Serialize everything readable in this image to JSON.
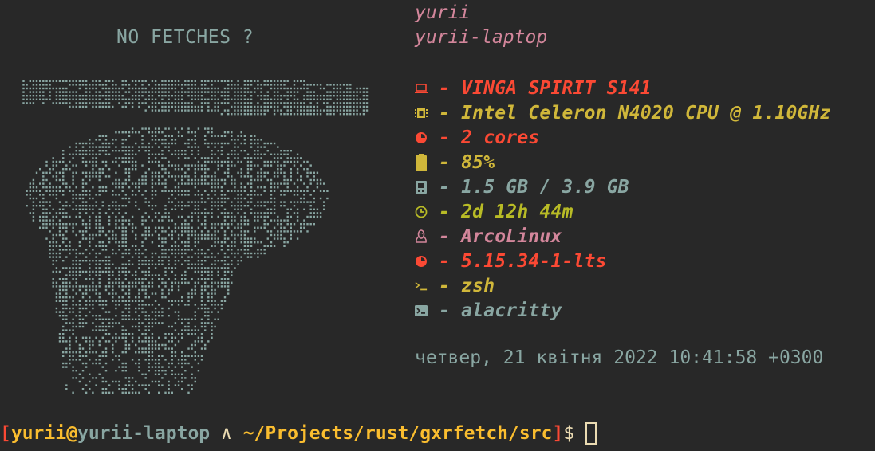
{
  "art": {
    "title": "NO FETCHES ?",
    "color": "#89a6a2"
  },
  "header": {
    "user": "yurii",
    "host": "yurii-laptop"
  },
  "info": [
    {
      "icon": "laptop-icon",
      "text": "- VINGA SPIRIT S141",
      "color": "#fb4934"
    },
    {
      "icon": "cpu-chip-icon",
      "text": "- Intel Celeron N4020 CPU @ 1.10GHz",
      "color": "#d0b73a"
    },
    {
      "icon": "pie-chart-icon",
      "text": "- 2 cores",
      "color": "#fb4934"
    },
    {
      "icon": "battery-icon",
      "text": "- 85%",
      "color": "#d0b73a"
    },
    {
      "icon": "memory-icon",
      "text": "- 1.5 GB / 3.9 GB",
      "color": "#89a6a2"
    },
    {
      "icon": "clock-icon",
      "text": "- 2d 12h 44m",
      "color": "#b8bb26"
    },
    {
      "icon": "linux-tux-icon",
      "text": "- ArcoLinux",
      "color": "#d3869b"
    },
    {
      "icon": "kernel-icon",
      "text": "- 5.15.34-1-lts",
      "color": "#fb4934"
    },
    {
      "icon": "shell-prompt-icon",
      "text": "- zsh",
      "color": "#d0b73a"
    },
    {
      "icon": "terminal-icon",
      "text": "- alacritty",
      "color": "#89a6a2"
    }
  ],
  "date": "четвер, 21 квітня 2022 10:41:58 +0300",
  "prompt": {
    "open_bracket": "[",
    "user": "yurii",
    "at": "@",
    "host": "yurii-laptop",
    "arrow": " ∧ ",
    "path": "~/Projects/rust/gxrfetch/src",
    "close_bracket": "]",
    "dollar": "$"
  },
  "colors": {
    "background": "#282828",
    "red": "#fb4934",
    "yellow": "#d0b73a",
    "aqua": "#89a6a2",
    "green": "#b8bb26",
    "purple": "#d3869b"
  }
}
